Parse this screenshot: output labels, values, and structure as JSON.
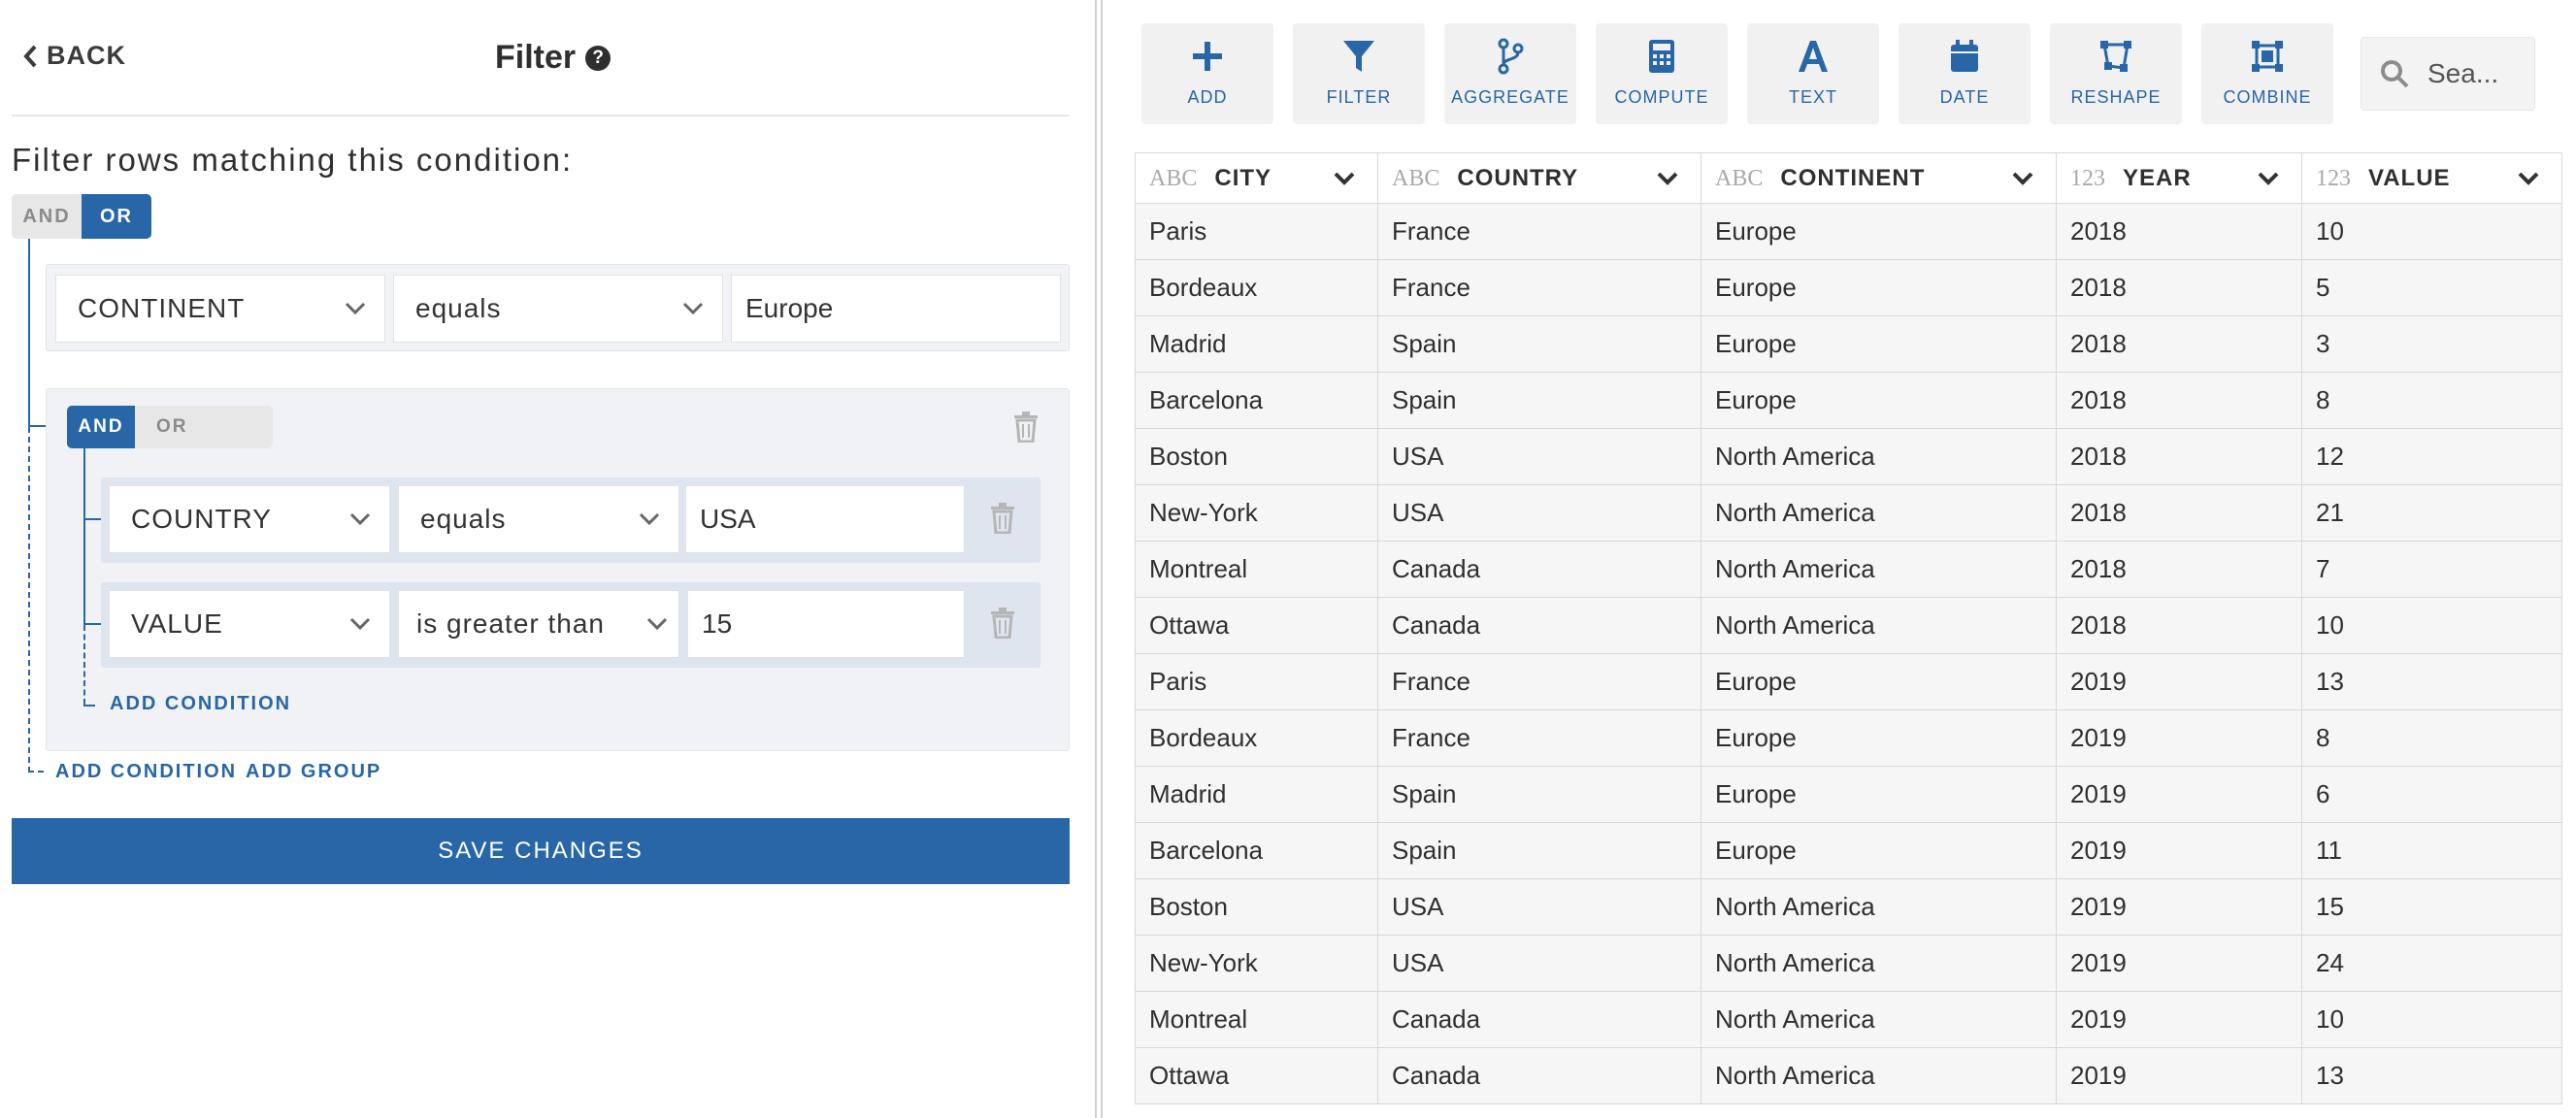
{
  "header": {
    "back_label": "BACK",
    "title": "Filter",
    "help_glyph": "?"
  },
  "filter": {
    "subtitle": "Filter rows matching this condition:",
    "root_toggle": {
      "and": "AND",
      "or": "OR",
      "active": "OR"
    },
    "condition1": {
      "column": "CONTINENT",
      "operator": "equals",
      "value": "Europe"
    },
    "group": {
      "toggle": {
        "and": "AND",
        "or": "OR",
        "active": "AND"
      },
      "condition1": {
        "column": "COUNTRY",
        "operator": "equals",
        "value": "USA"
      },
      "condition2": {
        "column": "VALUE",
        "operator": "is greater than",
        "value": "15"
      },
      "add_condition": "ADD CONDITION"
    },
    "add_condition": "ADD CONDITION",
    "add_group": "ADD GROUP",
    "save_label": "SAVE CHANGES"
  },
  "toolbar": {
    "items": [
      {
        "label": "ADD",
        "icon": "plus-icon"
      },
      {
        "label": "FILTER",
        "icon": "filter-icon"
      },
      {
        "label": "AGGREGATE",
        "icon": "aggregate-icon"
      },
      {
        "label": "COMPUTE",
        "icon": "calculator-icon"
      },
      {
        "label": "TEXT",
        "icon": "text-icon"
      },
      {
        "label": "DATE",
        "icon": "calendar-icon"
      },
      {
        "label": "RESHAPE",
        "icon": "reshape-icon"
      },
      {
        "label": "COMBINE",
        "icon": "combine-icon"
      }
    ],
    "search_placeholder": "Sea..."
  },
  "table": {
    "columns": [
      {
        "type": "ABC",
        "name": "CITY"
      },
      {
        "type": "ABC",
        "name": "COUNTRY"
      },
      {
        "type": "ABC",
        "name": "CONTINENT"
      },
      {
        "type": "123",
        "name": "YEAR"
      },
      {
        "type": "123",
        "name": "VALUE"
      }
    ],
    "rows": [
      [
        "Paris",
        "France",
        "Europe",
        "2018",
        "10"
      ],
      [
        "Bordeaux",
        "France",
        "Europe",
        "2018",
        "5"
      ],
      [
        "Madrid",
        "Spain",
        "Europe",
        "2018",
        "3"
      ],
      [
        "Barcelona",
        "Spain",
        "Europe",
        "2018",
        "8"
      ],
      [
        "Boston",
        "USA",
        "North America",
        "2018",
        "12"
      ],
      [
        "New-York",
        "USA",
        "North America",
        "2018",
        "21"
      ],
      [
        "Montreal",
        "Canada",
        "North America",
        "2018",
        "7"
      ],
      [
        "Ottawa",
        "Canada",
        "North America",
        "2018",
        "10"
      ],
      [
        "Paris",
        "France",
        "Europe",
        "2019",
        "13"
      ],
      [
        "Bordeaux",
        "France",
        "Europe",
        "2019",
        "8"
      ],
      [
        "Madrid",
        "Spain",
        "Europe",
        "2019",
        "6"
      ],
      [
        "Barcelona",
        "Spain",
        "Europe",
        "2019",
        "11"
      ],
      [
        "Boston",
        "USA",
        "North America",
        "2019",
        "15"
      ],
      [
        "New-York",
        "USA",
        "North America",
        "2019",
        "24"
      ],
      [
        "Montreal",
        "Canada",
        "North America",
        "2019",
        "10"
      ],
      [
        "Ottawa",
        "Canada",
        "North America",
        "2019",
        "13"
      ]
    ]
  },
  "colors": {
    "accent": "#2866a7",
    "toggle_off": "#e7e7e7",
    "cell_bg": "#f6f6f6"
  }
}
